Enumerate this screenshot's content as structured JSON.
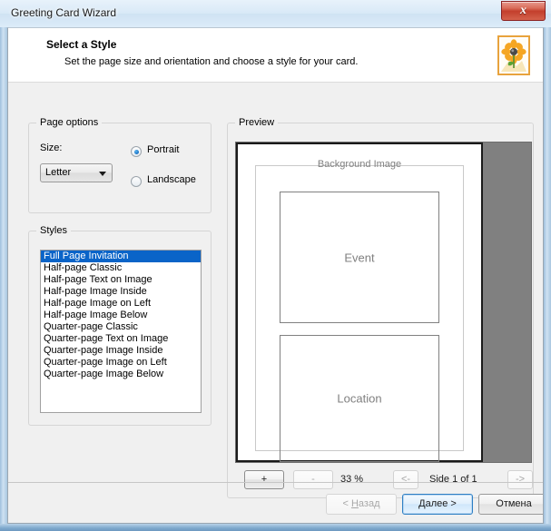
{
  "window": {
    "title": "Greeting Card Wizard",
    "close_icon": "close-icon",
    "close_glyph": "x"
  },
  "header": {
    "title": "Select a Style",
    "subtitle": "Set the page size and orientation and choose a style for your card.",
    "icon": "flower-picture-icon"
  },
  "page_options": {
    "legend": "Page options",
    "size_label": "Size:",
    "size_value": "Letter",
    "size_options": [
      "Letter"
    ],
    "orientation": {
      "portrait_label": "Portrait",
      "landscape_label": "Landscape",
      "selected": "Portrait"
    }
  },
  "styles": {
    "legend": "Styles",
    "selected_index": 0,
    "items": [
      "Full Page Invitation",
      "Half-page Classic",
      "Half-page Text on Image",
      "Half-page Image Inside",
      "Half-page Image on Left",
      "Half-page Image Below",
      "Quarter-page Classic",
      "Quarter-page Text on Image",
      "Quarter-page Image Inside",
      "Quarter-page Image on Left",
      "Quarter-page Image Below"
    ]
  },
  "preview": {
    "legend": "Preview",
    "page": {
      "background_label": "Background Image",
      "event_label": "Event",
      "location_label": "Location"
    },
    "toolbar": {
      "zoom_in_label": "+",
      "zoom_out_label": "-",
      "zoom_percent": "33 %",
      "prev_side_label": "<-",
      "side_status": "Side 1 of 1",
      "next_side_label": "->"
    }
  },
  "footer": {
    "back_label": "< Назад",
    "back_mnemonic": "Н",
    "back_prefix": "< ",
    "back_suffix": "азад",
    "next_label": "Далее >",
    "cancel_label": "Отмена"
  },
  "colors": {
    "selection_blue": "#0a64c8",
    "canvas_gray": "#808080",
    "accent_close_red": "#c33f2c"
  }
}
